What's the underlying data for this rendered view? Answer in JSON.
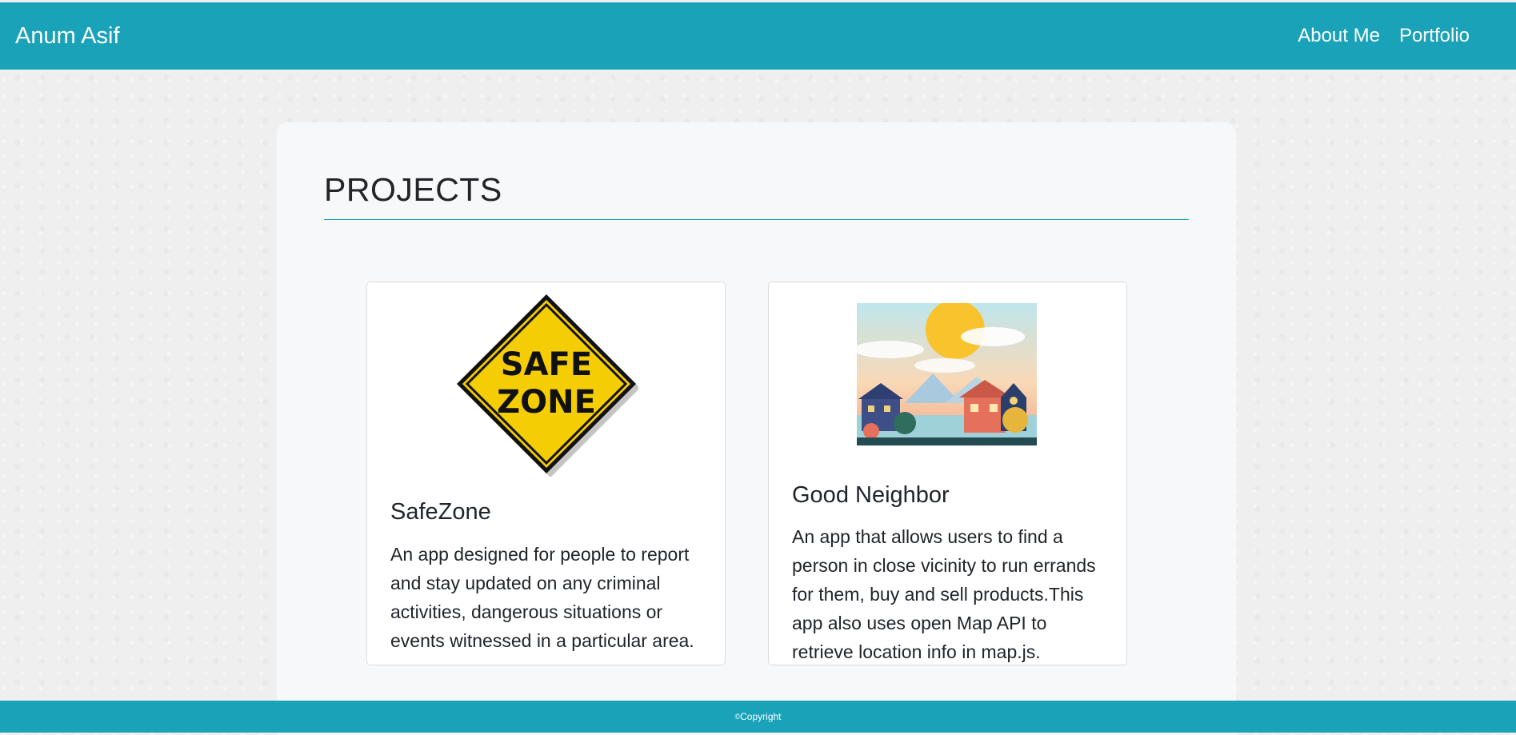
{
  "navbar": {
    "brand": "Anum Asif",
    "links": [
      {
        "label": "About Me"
      },
      {
        "label": "Portfolio"
      }
    ]
  },
  "section": {
    "title": "PROJECTS"
  },
  "projects": [
    {
      "title": "SafeZone",
      "image_icon": "safe-zone-sign",
      "sign_text_line1": "SAFE",
      "sign_text_line2": "ZONE",
      "description": "An app designed for people to report and stay updated on any criminal activities, dangerous situations or events witnessed in a particular area."
    },
    {
      "title": "Good Neighbor",
      "image_icon": "neighborhood-illustration",
      "description": "An app that allows users to find a person in close vicinity to run errands for them, buy and sell products.This app also uses open Map API to retrieve location info in map.js."
    }
  ],
  "footer": {
    "copyright_symbol": "©",
    "text": "Copyright"
  },
  "colors": {
    "accent": "#19a2b8",
    "background": "#eeefee",
    "panel": "#f7f8f9",
    "sign_yellow": "#f5cd05"
  }
}
